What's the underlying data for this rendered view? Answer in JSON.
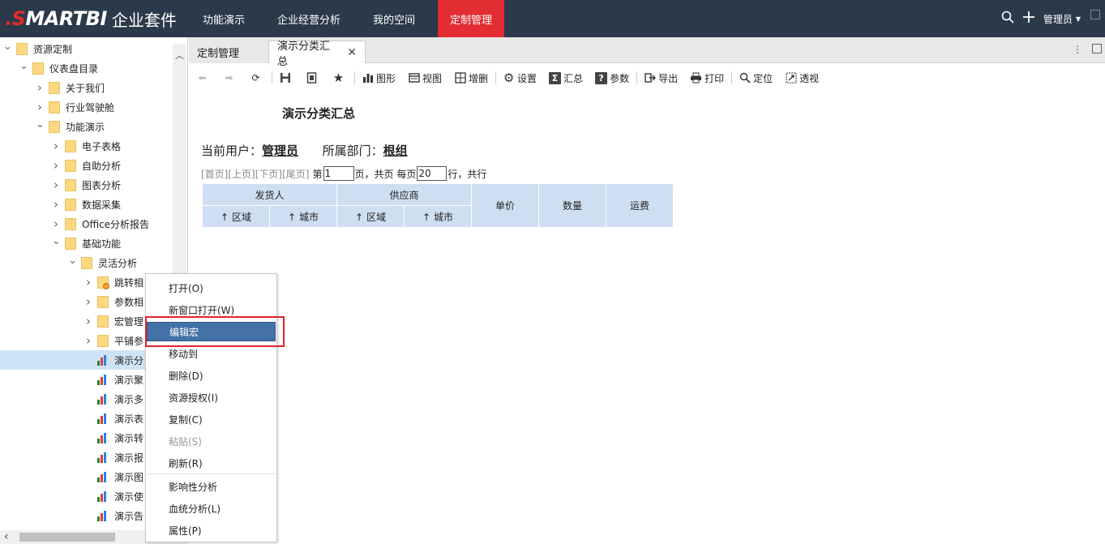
{
  "brand": {
    "red": ".S",
    "rest": "MARTBI",
    "suite": "企业套件"
  },
  "nav": [
    {
      "label": "功能演示"
    },
    {
      "label": "企业经营分析"
    },
    {
      "label": "我的空间"
    },
    {
      "label": "定制管理"
    }
  ],
  "user": {
    "name": "管理员"
  },
  "tree": [
    {
      "label": "资源定制"
    },
    {
      "label": "仪表盘目录"
    },
    {
      "label": "关于我们"
    },
    {
      "label": "行业驾驶舱"
    },
    {
      "label": "功能演示"
    },
    {
      "label": "电子表格"
    },
    {
      "label": "自助分析"
    },
    {
      "label": "图表分析"
    },
    {
      "label": "数据采集"
    },
    {
      "label": "Office分析报告"
    },
    {
      "label": "基础功能"
    },
    {
      "label": "灵活分析"
    },
    {
      "label": "跳转相"
    },
    {
      "label": "参数相"
    },
    {
      "label": "宏管理"
    },
    {
      "label": "平铺参"
    },
    {
      "label": "演示分"
    },
    {
      "label": "演示聚"
    },
    {
      "label": "演示多"
    },
    {
      "label": "演示表"
    },
    {
      "label": "演示转"
    },
    {
      "label": "演示报"
    },
    {
      "label": "演示图"
    },
    {
      "label": "演示使"
    },
    {
      "label": "演示告"
    }
  ],
  "tabs": [
    {
      "label": "定制管理"
    },
    {
      "label": "演示分类汇总"
    }
  ],
  "toolbar": [
    {
      "label": "图形"
    },
    {
      "label": "视图"
    },
    {
      "label": "增删"
    },
    {
      "label": "设置"
    },
    {
      "label": "汇总"
    },
    {
      "label": "参数"
    },
    {
      "label": "导出"
    },
    {
      "label": "打印"
    },
    {
      "label": "定位"
    },
    {
      "label": "透视"
    }
  ],
  "report": {
    "title": "演示分类汇总",
    "current_user_label": "当前用户：",
    "current_user": "管理员",
    "dept_label": "所属部门：",
    "dept": "根组"
  },
  "pager": {
    "first": "[首页]",
    "prev": "[上页]",
    "next": "[下页]",
    "last": "[尾页]",
    "page_prefix": "第",
    "page_value": "1",
    "page_suffix": "页，共页 每页",
    "rows_value": "20",
    "rows_suffix": "行，共行"
  },
  "table": {
    "group1": "发货人",
    "group2": "供应商",
    "region": "区域",
    "city": "城市",
    "price": "单价",
    "qty": "数量",
    "freight": "运费",
    "sort_arrow": "↑"
  },
  "context_menu": [
    {
      "label": "打开(O)"
    },
    {
      "label": "新窗口打开(W)"
    },
    {
      "label": "编辑宏"
    },
    {
      "label": "移动到"
    },
    {
      "label": "删除(D)"
    },
    {
      "label": "资源授权(I)"
    },
    {
      "label": "复制(C)"
    },
    {
      "label": "粘贴(S)"
    },
    {
      "label": "刷新(R)"
    },
    {
      "label": "影响性分析"
    },
    {
      "label": "血统分析(L)"
    },
    {
      "label": "属性(P)"
    }
  ]
}
